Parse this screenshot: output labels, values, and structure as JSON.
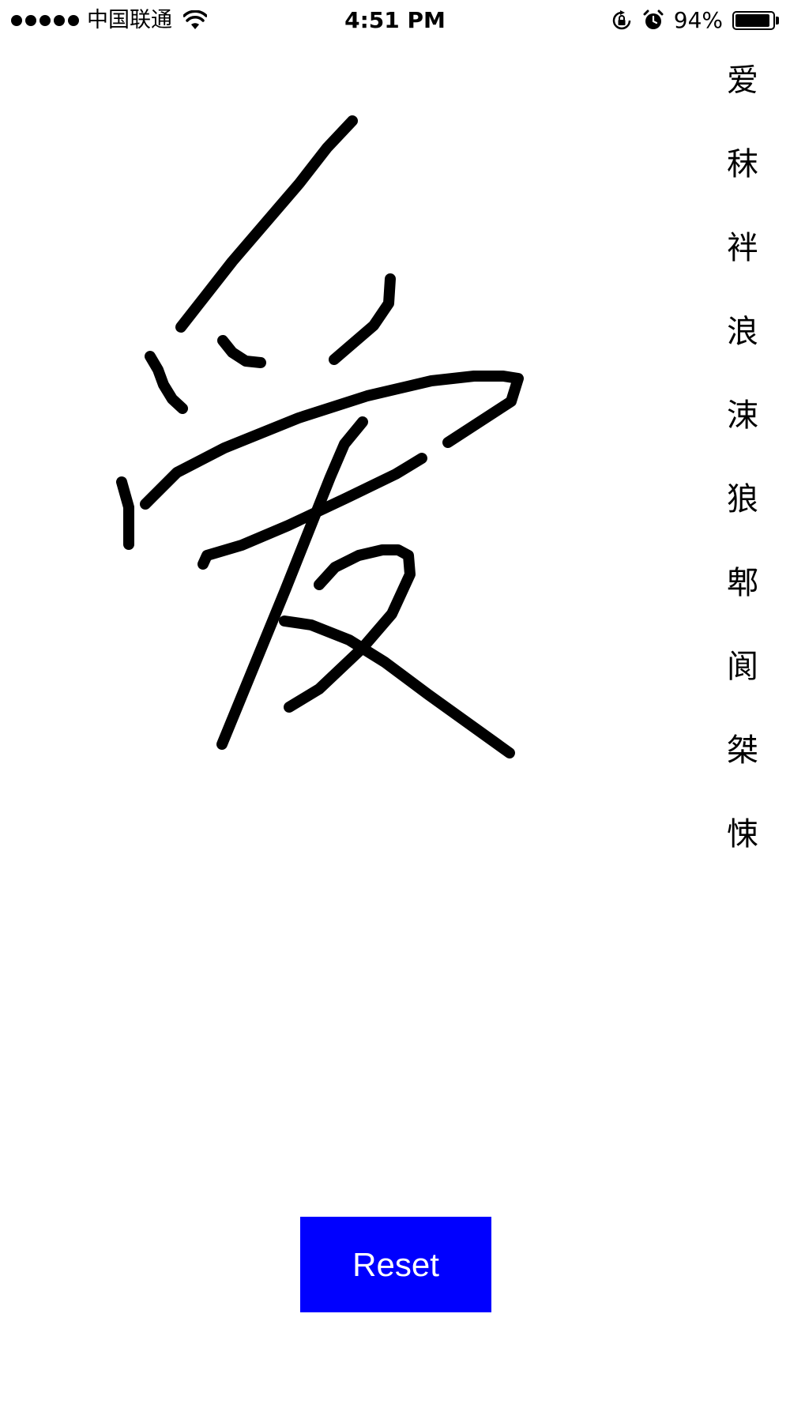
{
  "status_bar": {
    "carrier": "中国联通",
    "time": "4:51 PM",
    "battery_percent": "94%",
    "battery_level": 0.94,
    "icons": [
      "signal-dots",
      "wifi-icon",
      "rotation-lock-icon",
      "alarm-icon",
      "battery-icon"
    ]
  },
  "candidates": [
    "爱",
    "秣",
    "袢",
    "浪",
    "涑",
    "狼",
    "郫",
    "阆",
    "桀",
    "悚"
  ],
  "reset_button": {
    "label": "Reset",
    "color": "#0000ff",
    "text_color": "#ffffff"
  }
}
